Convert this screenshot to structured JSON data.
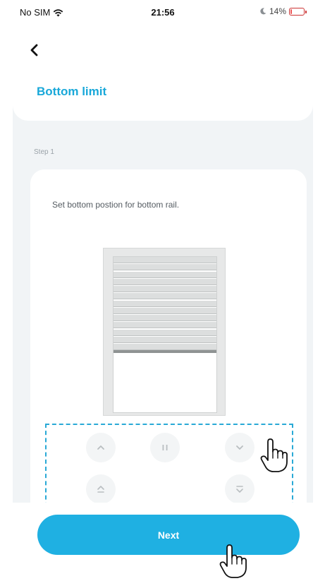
{
  "status_bar": {
    "carrier": "No SIM",
    "time": "21:56",
    "battery_percent": "14%",
    "battery_level": 0.14,
    "icons": [
      "wifi-icon",
      "moon-icon",
      "battery-charging-icon"
    ]
  },
  "header": {
    "back_icon": "chevron-left-icon",
    "title": "Bottom limit"
  },
  "step": {
    "label": "Step 1",
    "instruction": "Set bottom postion for bottom rail."
  },
  "blind": {
    "slat_count": 13,
    "lowered_fraction": 0.6
  },
  "controls": [
    {
      "name": "up-button",
      "icon": "chevron-up-icon"
    },
    {
      "name": "pause-button",
      "icon": "pause-icon"
    },
    {
      "name": "down-button",
      "icon": "chevron-down-icon"
    },
    {
      "name": "fully-up-button",
      "icon": "double-chevron-up-icon"
    },
    {
      "name": "fully-down-button",
      "icon": "double-chevron-down-icon"
    }
  ],
  "footer": {
    "next_label": "Next"
  },
  "colors": {
    "accent": "#1fb0e2",
    "title": "#19a8d9",
    "highlight_dash": "#29a9d6",
    "background": "#f1f4f6"
  },
  "annotations": [
    "hand-pointer-icon",
    "hand-pointer-icon"
  ]
}
